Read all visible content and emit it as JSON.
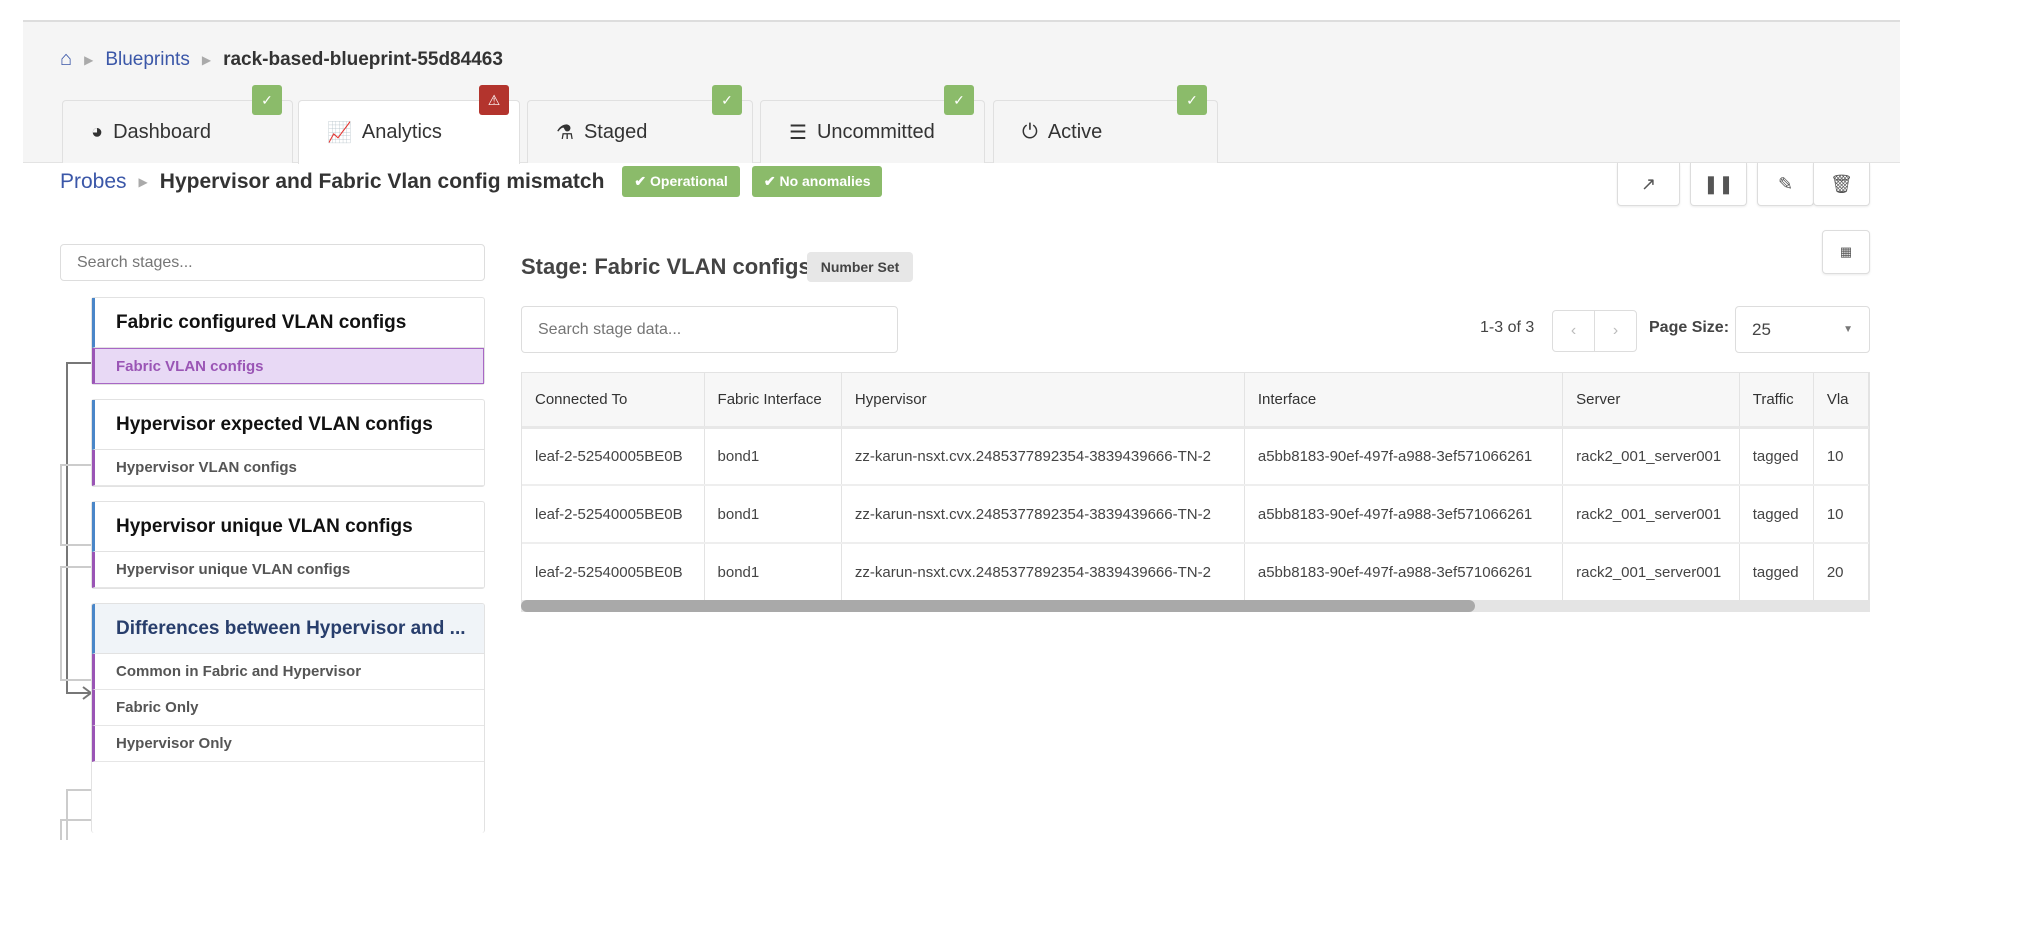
{
  "breadcrumb": {
    "home_icon": "home-icon",
    "blueprints": "Blueprints",
    "current": "rack-based-blueprint-55d84463"
  },
  "tabs": [
    {
      "label": "Dashboard",
      "icon": "dashboard-icon",
      "status": "ok"
    },
    {
      "label": "Analytics",
      "icon": "line-chart-icon",
      "status": "warning"
    },
    {
      "label": "Staged",
      "icon": "flask-icon",
      "status": "ok"
    },
    {
      "label": "Uncommitted",
      "icon": "tasks-icon",
      "status": "ok"
    },
    {
      "label": "Active",
      "icon": "power-icon",
      "status": "ok"
    }
  ],
  "probe": {
    "probes_link": "Probes",
    "title": "Hypervisor and Fabric Vlan config mismatch",
    "state": "Operational",
    "anomalies": "No anomalies"
  },
  "colors": {
    "ok": "#8bbb6a",
    "warning": "#b3342d",
    "link": "#3b57a8",
    "selected_stage": "#e8d9f5"
  },
  "stages_search_placeholder": "Search stages...",
  "stages": [
    {
      "title": "Fabric configured VLAN configs",
      "outputs": [
        "Fabric VLAN configs"
      ]
    },
    {
      "title": "Hypervisor expected VLAN configs",
      "outputs": [
        "Hypervisor VLAN configs"
      ]
    },
    {
      "title": "Hypervisor unique VLAN configs",
      "outputs": [
        "Hypervisor unique VLAN configs"
      ]
    },
    {
      "title": "Differences between Hypervisor and ...",
      "outputs": [
        "Common in Fabric and Hypervisor",
        "Fabric Only",
        "Hypervisor Only"
      ]
    }
  ],
  "stage": {
    "title": "Stage: Fabric VLAN configs",
    "type": "Number Set",
    "search_placeholder": "Search stage data...",
    "range": "1-3 of 3",
    "page_size_label": "Page Size:",
    "page_size": "25"
  },
  "table": {
    "columns": [
      "Connected To",
      "Fabric Interface",
      "Hypervisor",
      "Interface",
      "Server",
      "Traffic",
      "Vla"
    ],
    "rows": [
      [
        "leaf-2-52540005BE0B",
        "bond1",
        "zz-karun-nsxt.cvx.2485377892354-3839439666-TN-2",
        "a5bb8183-90ef-497f-a988-3ef571066261",
        "rack2_001_server001",
        "tagged",
        "10"
      ],
      [
        "leaf-2-52540005BE0B",
        "bond1",
        "zz-karun-nsxt.cvx.2485377892354-3839439666-TN-2",
        "a5bb8183-90ef-497f-a988-3ef571066261",
        "rack2_001_server001",
        "tagged",
        "10"
      ],
      [
        "leaf-2-52540005BE0B",
        "bond1",
        "zz-karun-nsxt.cvx.2485377892354-3839439666-TN-2",
        "a5bb8183-90ef-497f-a988-3ef571066261",
        "rack2_001_server001",
        "tagged",
        "20"
      ]
    ]
  }
}
